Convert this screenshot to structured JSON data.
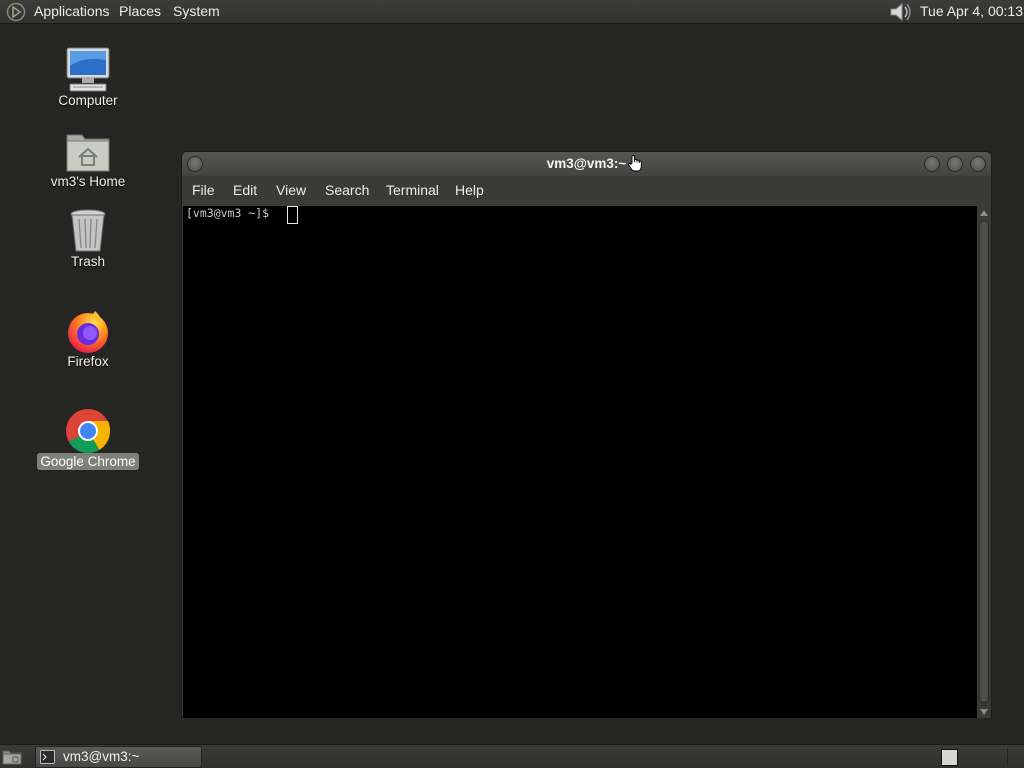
{
  "top_panel": {
    "menus": [
      "Applications",
      "Places",
      "System"
    ],
    "clock": "Tue Apr  4, 00:13",
    "icons": {
      "main_menu": "gnome-foot-icon",
      "volume": "speaker-icon"
    }
  },
  "desktop": {
    "icons": [
      {
        "label": "Computer",
        "icon": "computer-icon"
      },
      {
        "label": "vm3's Home",
        "icon": "home-folder-icon"
      },
      {
        "label": "Trash",
        "icon": "trash-icon"
      },
      {
        "label": "Firefox",
        "icon": "firefox-icon"
      },
      {
        "label": "Google Chrome",
        "icon": "chrome-icon",
        "selected": true
      }
    ]
  },
  "terminal_window": {
    "title": "vm3@vm3:~",
    "menu": [
      "File",
      "Edit",
      "View",
      "Search",
      "Terminal",
      "Help"
    ],
    "prompt": "[vm3@vm3 ~]$ "
  },
  "bottom_panel": {
    "tasks": [
      {
        "label": "vm3@vm3:~",
        "icon": "terminal-icon"
      }
    ],
    "icons": {
      "show_desktop": "show-desktop-icon",
      "workspace": "workspace-switcher"
    }
  },
  "colors": {
    "desktop_bg": "#252523",
    "panel_bg": "#363634",
    "terminal_bg": "#000000",
    "text": "#ececec"
  }
}
